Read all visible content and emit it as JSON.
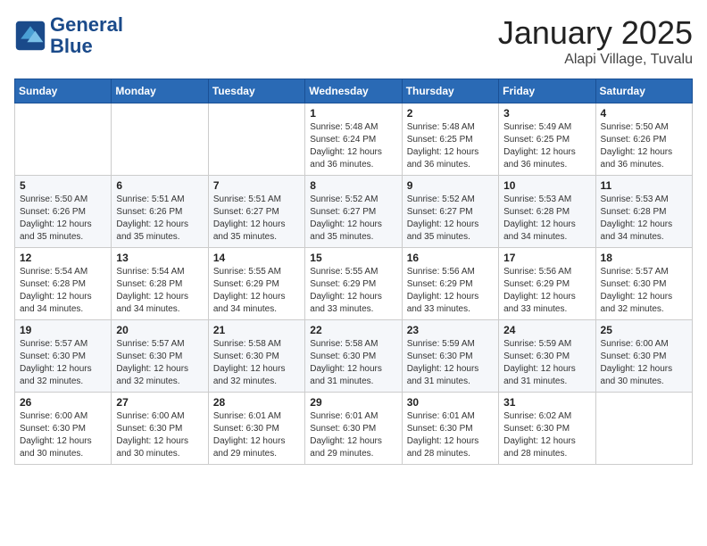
{
  "header": {
    "logo_line1": "General",
    "logo_line2": "Blue",
    "month": "January 2025",
    "location": "Alapi Village, Tuvalu"
  },
  "weekdays": [
    "Sunday",
    "Monday",
    "Tuesday",
    "Wednesday",
    "Thursday",
    "Friday",
    "Saturday"
  ],
  "weeks": [
    [
      {
        "day": "",
        "info": ""
      },
      {
        "day": "",
        "info": ""
      },
      {
        "day": "",
        "info": ""
      },
      {
        "day": "1",
        "info": "Sunrise: 5:48 AM\nSunset: 6:24 PM\nDaylight: 12 hours\nand 36 minutes."
      },
      {
        "day": "2",
        "info": "Sunrise: 5:48 AM\nSunset: 6:25 PM\nDaylight: 12 hours\nand 36 minutes."
      },
      {
        "day": "3",
        "info": "Sunrise: 5:49 AM\nSunset: 6:25 PM\nDaylight: 12 hours\nand 36 minutes."
      },
      {
        "day": "4",
        "info": "Sunrise: 5:50 AM\nSunset: 6:26 PM\nDaylight: 12 hours\nand 36 minutes."
      }
    ],
    [
      {
        "day": "5",
        "info": "Sunrise: 5:50 AM\nSunset: 6:26 PM\nDaylight: 12 hours\nand 35 minutes."
      },
      {
        "day": "6",
        "info": "Sunrise: 5:51 AM\nSunset: 6:26 PM\nDaylight: 12 hours\nand 35 minutes."
      },
      {
        "day": "7",
        "info": "Sunrise: 5:51 AM\nSunset: 6:27 PM\nDaylight: 12 hours\nand 35 minutes."
      },
      {
        "day": "8",
        "info": "Sunrise: 5:52 AM\nSunset: 6:27 PM\nDaylight: 12 hours\nand 35 minutes."
      },
      {
        "day": "9",
        "info": "Sunrise: 5:52 AM\nSunset: 6:27 PM\nDaylight: 12 hours\nand 35 minutes."
      },
      {
        "day": "10",
        "info": "Sunrise: 5:53 AM\nSunset: 6:28 PM\nDaylight: 12 hours\nand 34 minutes."
      },
      {
        "day": "11",
        "info": "Sunrise: 5:53 AM\nSunset: 6:28 PM\nDaylight: 12 hours\nand 34 minutes."
      }
    ],
    [
      {
        "day": "12",
        "info": "Sunrise: 5:54 AM\nSunset: 6:28 PM\nDaylight: 12 hours\nand 34 minutes."
      },
      {
        "day": "13",
        "info": "Sunrise: 5:54 AM\nSunset: 6:28 PM\nDaylight: 12 hours\nand 34 minutes."
      },
      {
        "day": "14",
        "info": "Sunrise: 5:55 AM\nSunset: 6:29 PM\nDaylight: 12 hours\nand 34 minutes."
      },
      {
        "day": "15",
        "info": "Sunrise: 5:55 AM\nSunset: 6:29 PM\nDaylight: 12 hours\nand 33 minutes."
      },
      {
        "day": "16",
        "info": "Sunrise: 5:56 AM\nSunset: 6:29 PM\nDaylight: 12 hours\nand 33 minutes."
      },
      {
        "day": "17",
        "info": "Sunrise: 5:56 AM\nSunset: 6:29 PM\nDaylight: 12 hours\nand 33 minutes."
      },
      {
        "day": "18",
        "info": "Sunrise: 5:57 AM\nSunset: 6:30 PM\nDaylight: 12 hours\nand 32 minutes."
      }
    ],
    [
      {
        "day": "19",
        "info": "Sunrise: 5:57 AM\nSunset: 6:30 PM\nDaylight: 12 hours\nand 32 minutes."
      },
      {
        "day": "20",
        "info": "Sunrise: 5:57 AM\nSunset: 6:30 PM\nDaylight: 12 hours\nand 32 minutes."
      },
      {
        "day": "21",
        "info": "Sunrise: 5:58 AM\nSunset: 6:30 PM\nDaylight: 12 hours\nand 32 minutes."
      },
      {
        "day": "22",
        "info": "Sunrise: 5:58 AM\nSunset: 6:30 PM\nDaylight: 12 hours\nand 31 minutes."
      },
      {
        "day": "23",
        "info": "Sunrise: 5:59 AM\nSunset: 6:30 PM\nDaylight: 12 hours\nand 31 minutes."
      },
      {
        "day": "24",
        "info": "Sunrise: 5:59 AM\nSunset: 6:30 PM\nDaylight: 12 hours\nand 31 minutes."
      },
      {
        "day": "25",
        "info": "Sunrise: 6:00 AM\nSunset: 6:30 PM\nDaylight: 12 hours\nand 30 minutes."
      }
    ],
    [
      {
        "day": "26",
        "info": "Sunrise: 6:00 AM\nSunset: 6:30 PM\nDaylight: 12 hours\nand 30 minutes."
      },
      {
        "day": "27",
        "info": "Sunrise: 6:00 AM\nSunset: 6:30 PM\nDaylight: 12 hours\nand 30 minutes."
      },
      {
        "day": "28",
        "info": "Sunrise: 6:01 AM\nSunset: 6:30 PM\nDaylight: 12 hours\nand 29 minutes."
      },
      {
        "day": "29",
        "info": "Sunrise: 6:01 AM\nSunset: 6:30 PM\nDaylight: 12 hours\nand 29 minutes."
      },
      {
        "day": "30",
        "info": "Sunrise: 6:01 AM\nSunset: 6:30 PM\nDaylight: 12 hours\nand 28 minutes."
      },
      {
        "day": "31",
        "info": "Sunrise: 6:02 AM\nSunset: 6:30 PM\nDaylight: 12 hours\nand 28 minutes."
      },
      {
        "day": "",
        "info": ""
      }
    ]
  ]
}
